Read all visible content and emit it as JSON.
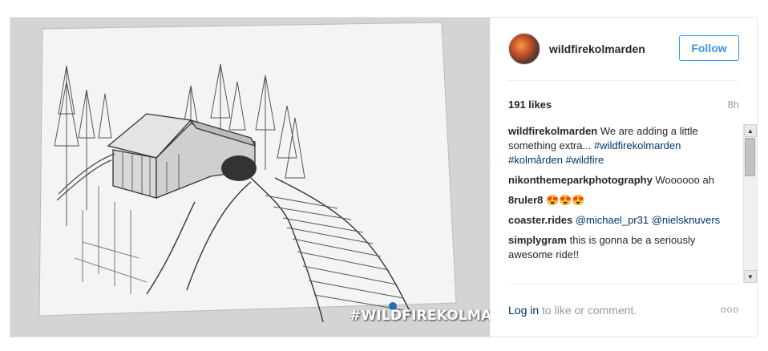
{
  "photo": {
    "overlay_hashtag": "#WILDFIREKOLMARDEN",
    "description_icon": "pencil-sketch-image"
  },
  "header": {
    "username": "wildfirekolmarden",
    "follow_label": "Follow"
  },
  "stats": {
    "likes": "191 likes",
    "age": "8h"
  },
  "comments": [
    {
      "author": "wildfirekolmarden",
      "text": " We are adding a little something extra... ",
      "tags": "#wildfirekolmarden #kolmården #wildfire"
    },
    {
      "author": "nikonthemeparkphotography",
      "text": " Woooooo ah",
      "tags": ""
    },
    {
      "author": "8ruler8",
      "text": " 😍😍😍",
      "tags": ""
    },
    {
      "author": "coaster.rides",
      "text": " ",
      "tags": "@michael_pr31 @nielsknuvers"
    },
    {
      "author": "simplygram",
      "text": " this is gonna be a seriously awesome ride!!",
      "tags": ""
    }
  ],
  "footer": {
    "login_link": "Log in",
    "login_rest": " to like or comment.",
    "more": "ooo"
  },
  "colors": {
    "accent": "#3897f0",
    "link": "#003569",
    "muted": "#999999"
  }
}
